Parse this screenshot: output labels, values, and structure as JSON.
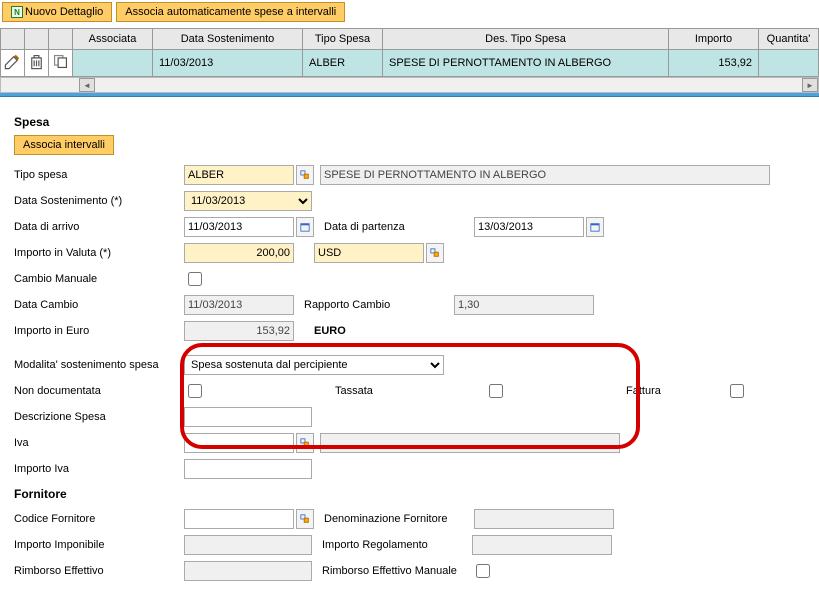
{
  "toolbar": {
    "newDetail": "Nuovo Dettaglio",
    "autoAssociate": "Associa automaticamente spese a intervalli"
  },
  "grid": {
    "headers": {
      "associata": "Associata",
      "dataSost": "Data Sostenimento",
      "tipoSpesa": "Tipo Spesa",
      "desTipoSpesa": "Des. Tipo Spesa",
      "importo": "Importo",
      "quantita": "Quantita'"
    },
    "row": {
      "associata": "",
      "dataSost": "11/03/2013",
      "tipoSpesa": "ALBER",
      "desTipoSpesa": "SPESE DI PERNOTTAMENTO IN ALBERGO",
      "importo": "153,92",
      "quantita": ""
    }
  },
  "form": {
    "section_spesa": "Spesa",
    "btn_associa": "Associa intervalli",
    "labels": {
      "tipoSpesa": "Tipo spesa",
      "dataSost": "Data Sostenimento (*)",
      "dataArrivo": "Data di arrivo",
      "dataPartenza": "Data di partenza",
      "importoValuta": "Importo in Valuta (*)",
      "cambioManuale": "Cambio Manuale",
      "dataCambio": "Data Cambio",
      "rapportoCambio": "Rapporto Cambio",
      "importoEuro": "Importo in Euro",
      "modalita": "Modalita' sostenimento spesa",
      "nonDoc": "Non documentata",
      "tassata": "Tassata",
      "fattura": "Fattura",
      "descSpesa": "Descrizione Spesa",
      "iva": "Iva",
      "importoIva": "Importo Iva",
      "section_fornitore": "Fornitore",
      "codFornitore": "Codice Fornitore",
      "denomFornitore": "Denominazione Fornitore",
      "impImponibile": "Importo Imponibile",
      "impRegolamento": "Importo Regolamento",
      "rimbEffettivo": "Rimborso Effettivo",
      "rimbEffManuale": "Rimborso Effettivo Manuale"
    },
    "values": {
      "tipoSpesa": "ALBER",
      "tipoSpesaDesc": "SPESE DI PERNOTTAMENTO IN ALBERGO",
      "dataSost": "11/03/2013",
      "dataArrivo": "11/03/2013",
      "dataPartenza": "13/03/2013",
      "importoValuta": "200,00",
      "valuta": "USD",
      "dataCambio": "11/03/2013",
      "rapportoCambio": "1,30",
      "importoEuro": "153,92",
      "euroLabel": "EURO",
      "modalita": "Spesa sostenuta dal percipiente",
      "descSpesa": "",
      "iva": "",
      "ivaDesc": "",
      "importoIva": "",
      "codFornitore": "",
      "denomFornitore": "",
      "impImponibile": "",
      "impRegolamento": "",
      "rimbEffettivo": ""
    }
  }
}
